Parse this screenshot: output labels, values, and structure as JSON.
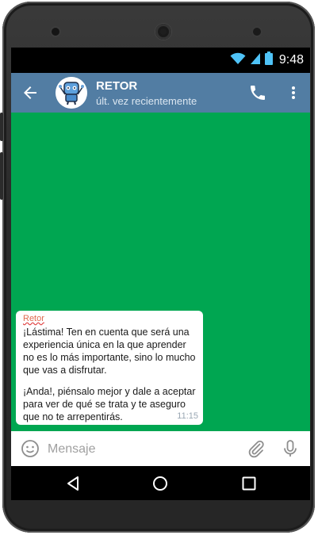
{
  "status_bar": {
    "time": "9:48"
  },
  "chat_header": {
    "title": "RETOR",
    "subtitle": "últ. vez recientemente"
  },
  "message": {
    "sender": "Retor",
    "paragraphs": [
      "¡Lástima! Ten en cuenta que será una\nexperiencia única en la que aprender\nno es lo más importante, sino lo mucho\nque vas a disfrutar.",
      "¡Anda!, piénsalo mejor y dale a aceptar\npara ver de qué se trata y te aseguro\nque no te arrepentirás."
    ],
    "time": "11:15"
  },
  "composer": {
    "placeholder": "Mensaje"
  },
  "colors": {
    "app_bar": "#527da3",
    "chat_background": "#00a651",
    "bubble": "#ffffff",
    "sender_name": "#e06a50"
  },
  "icons": [
    "wifi-icon",
    "signal-icon",
    "battery-icon",
    "back-arrow-icon",
    "phone-icon",
    "more-vert-icon",
    "emoji-icon",
    "attach-icon",
    "mic-icon",
    "back-triangle-icon",
    "home-circle-icon",
    "recents-square-icon"
  ]
}
